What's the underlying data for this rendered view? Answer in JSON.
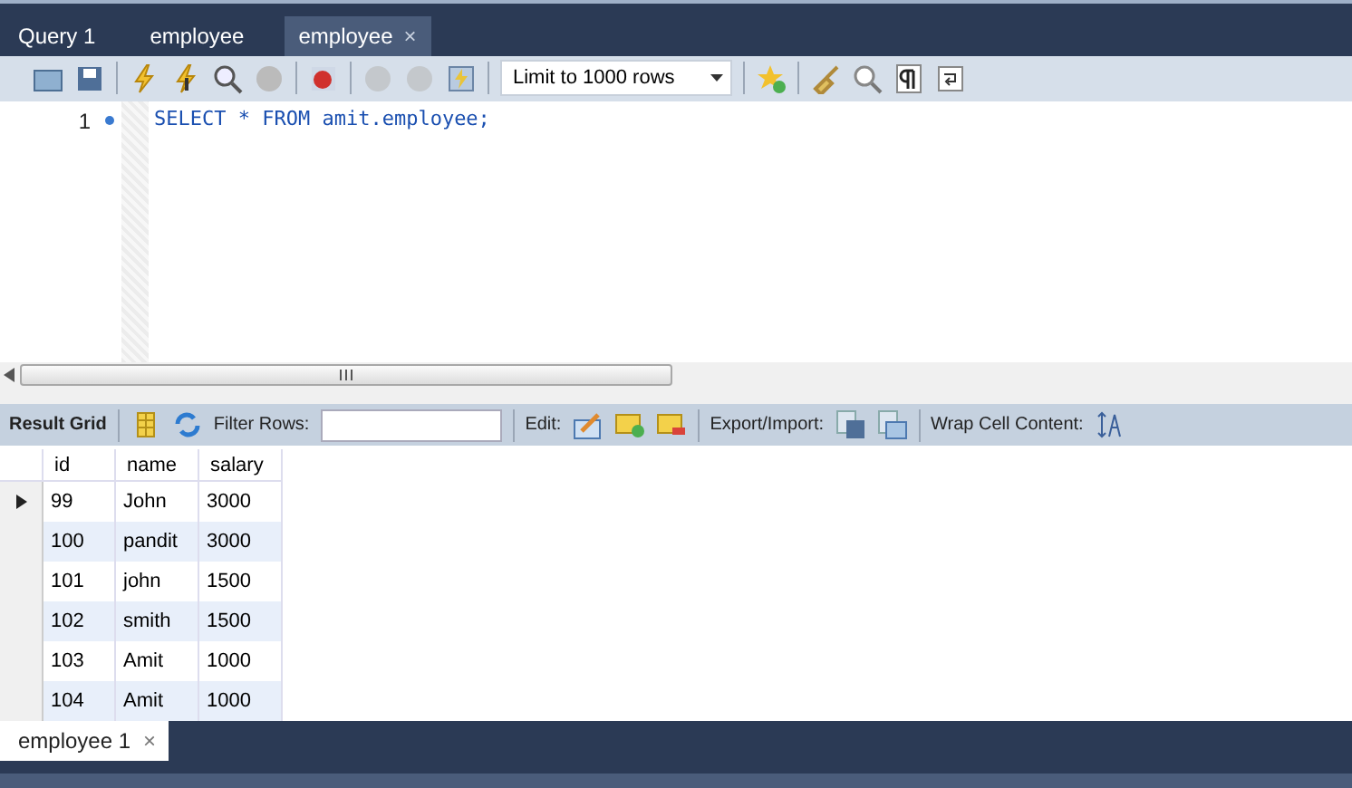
{
  "tabs": [
    {
      "label": "Query 1",
      "selected": false
    },
    {
      "label": "employee",
      "selected": false
    },
    {
      "label": "employee",
      "selected": true,
      "close": "×"
    }
  ],
  "toolbar": {
    "limit": "Limit to 1000 rows"
  },
  "editor": {
    "lines": [
      {
        "number": "1",
        "code": "SELECT * FROM amit.employee;"
      }
    ]
  },
  "result_toolbar": {
    "result_grid": "Result Grid",
    "filter_label": "Filter Rows:",
    "edit_label": "Edit:",
    "export_label": "Export/Import:",
    "wrap_label": "Wrap Cell Content:"
  },
  "grid": {
    "columns": [
      "id",
      "name",
      "salary"
    ],
    "rows": [
      {
        "cells": [
          "99",
          "John",
          "3000"
        ],
        "current": true
      },
      {
        "cells": [
          "100",
          "pandit",
          "3000"
        ],
        "current": false
      },
      {
        "cells": [
          "101",
          "john",
          "1500"
        ],
        "current": false
      },
      {
        "cells": [
          "102",
          "smith",
          "1500"
        ],
        "current": false
      },
      {
        "cells": [
          "103",
          "Amit",
          "1000"
        ],
        "current": false
      },
      {
        "cells": [
          "104",
          "Amit",
          "1000"
        ],
        "current": false
      }
    ]
  },
  "result_tabs": [
    {
      "label": "employee 1",
      "selected": true,
      "close": "×"
    }
  ]
}
